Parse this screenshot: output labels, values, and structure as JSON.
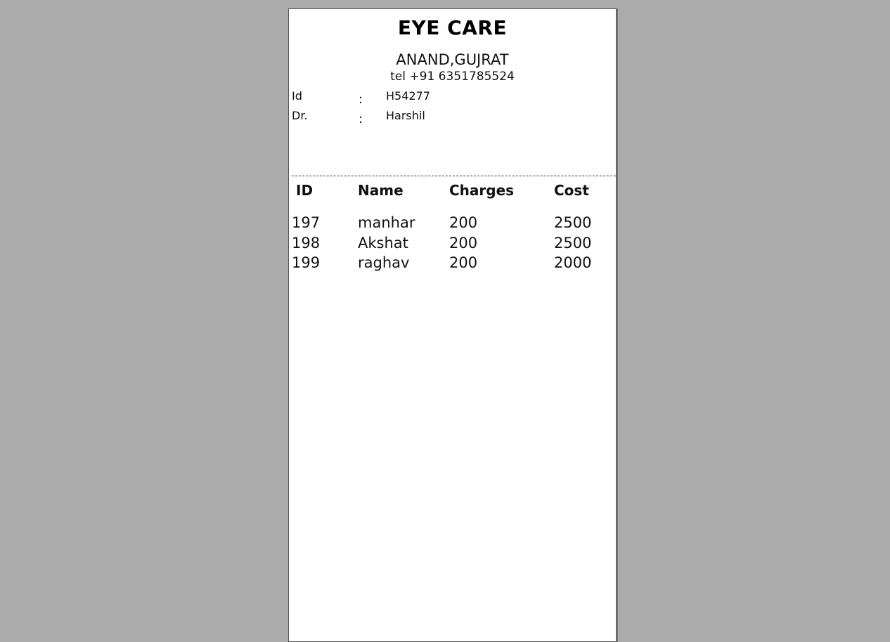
{
  "receipt": {
    "title": "EYE CARE",
    "address": "ANAND,GUJRAT",
    "tel": "tel +91 6351785524",
    "meta": [
      {
        "label": "Id",
        "separator": ":",
        "value": "H54277"
      },
      {
        "label": "Dr.",
        "separator": ":",
        "value": "Harshil"
      }
    ],
    "table": {
      "columns": [
        "ID",
        "Name",
        "Charges",
        "Cost"
      ],
      "rows": [
        [
          "197",
          "manhar",
          "200",
          "2500"
        ],
        [
          "198",
          "Akshat",
          "200",
          "2500"
        ],
        [
          "199",
          "raghav",
          "200",
          "2000"
        ]
      ]
    }
  },
  "colors": {
    "background": "#ababab",
    "paper": "#ffffff",
    "text": "#111111"
  }
}
